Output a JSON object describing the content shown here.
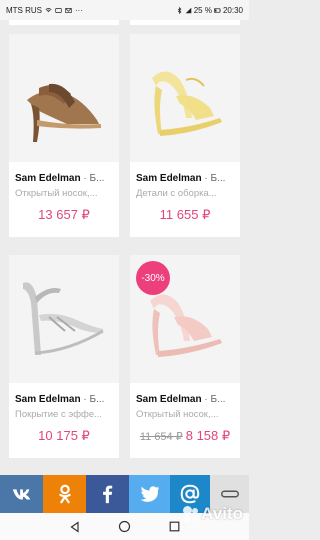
{
  "status": {
    "carrier": "MTS RUS",
    "battery": "25 %",
    "time": "20:30"
  },
  "products": [
    {
      "brand": "Sam Edelman",
      "sep": " · Б...",
      "desc": "Открытый носок,...",
      "price": "13 657 ₽",
      "old_price": "",
      "badge": ""
    },
    {
      "brand": "Sam Edelman",
      "sep": " · Б...",
      "desc": "Детали с оборка...",
      "price": "11 655 ₽",
      "old_price": "",
      "badge": ""
    },
    {
      "brand": "Sam Edelman",
      "sep": " · Б...",
      "desc": "Покрытие с эффе...",
      "price": "10 175 ₽",
      "old_price": "",
      "badge": ""
    },
    {
      "brand": "Sam Edelman",
      "sep": " · Б...",
      "desc": "Открытый носок,...",
      "price": "8 158 ₽",
      "old_price": "11 654 ₽",
      "badge": "-30%"
    }
  ],
  "share": [
    {
      "name": "vk",
      "color": "#4a76a8"
    },
    {
      "name": "ok",
      "color": "#ee8208"
    },
    {
      "name": "facebook",
      "color": "#3b5998"
    },
    {
      "name": "twitter",
      "color": "#55acee"
    },
    {
      "name": "email",
      "color": "#1c87c9"
    },
    {
      "name": "more",
      "color": "#e0e0e0"
    }
  ],
  "watermark": "Avito",
  "colors": {
    "price": "#e2457c",
    "badge": "#ec3f7c"
  }
}
